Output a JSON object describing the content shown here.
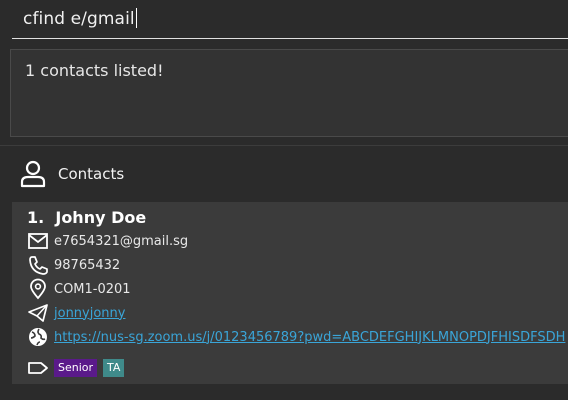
{
  "command": {
    "value": "cfind e/gmail"
  },
  "result": {
    "message": "1 contacts listed!"
  },
  "contacts_panel": {
    "title": "Contacts",
    "icon": "person-icon"
  },
  "contacts": [
    {
      "index": "1.",
      "name": "Johny Doe",
      "email": "e7654321@gmail.sg",
      "phone": "98765432",
      "address": "COM1-0201",
      "telegram": "jonnyjonny",
      "zoom": "https://nus-sg.zoom.us/j/0123456789?pwd=ABCDEFGHIJKLMNOPDJFHISDFSDH",
      "tags": [
        "Senior",
        "TA"
      ]
    }
  ],
  "colors": {
    "background": "#2b2b2b",
    "card": "#3b3b3b",
    "link": "#3aa5d8",
    "tag_senior": "#5a1a8a",
    "tag_ta": "#3f8a8a"
  }
}
